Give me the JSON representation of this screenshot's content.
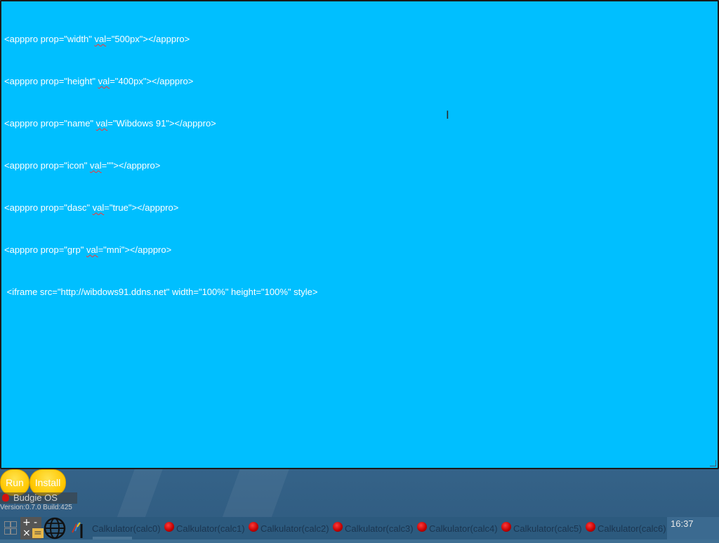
{
  "editor": {
    "lines": [
      {
        "before": "<apppro prop=\"width\" ",
        "spell": "val",
        "after": "=\"500px\"></apppro>"
      },
      {
        "before": "<apppro prop=\"height\" ",
        "spell": "val",
        "after": "=\"400px\"></apppro>"
      },
      {
        "before": "<apppro prop=\"name\" ",
        "spell": "val",
        "after": "=\"Wibdows 91\"></apppro>"
      },
      {
        "before": "<apppro prop=\"icon\" ",
        "spell": "val",
        "after": "=\"\"></apppro>"
      },
      {
        "before": "<apppro prop=\"dasc\" ",
        "spell": "val",
        "after": "=\"true\"></apppro>"
      },
      {
        "before": "<apppro prop=\"grp\" ",
        "spell": "val",
        "after": "=\"mni\"></apppro>"
      },
      {
        "before": " <iframe src=\"http://wibdows91.ddns.net\" width=\"100%\" height=\"100%\" style>",
        "spell": "",
        "after": ""
      }
    ],
    "cursor_glyph": "I"
  },
  "buttons": {
    "run": "Run",
    "install": "Install"
  },
  "brand": {
    "name": "Budgie OS",
    "version": "Version:0.7.0  Build:425"
  },
  "taskbar": {
    "launchers": [
      "apps-grid-icon",
      "calculator-icon",
      "globe-icon",
      "paint-brush-icon"
    ],
    "calc_symbols": {
      "plus": "+",
      "minus": "-",
      "times": "×",
      "equals": "="
    },
    "tasks": [
      "Calkulator(calc0)",
      "Calkulator(calc1)",
      "Calkulator(calc2)",
      "Calkulator(calc3)",
      "Calkulator(calc4)",
      "Calkulator(calc5)",
      "Calkulator(calc6)"
    ],
    "clock": "16:37"
  },
  "colors": {
    "editor_bg": "#00bfff",
    "button_yellow": "#ffc700",
    "task_dot_red": "#c00000"
  }
}
